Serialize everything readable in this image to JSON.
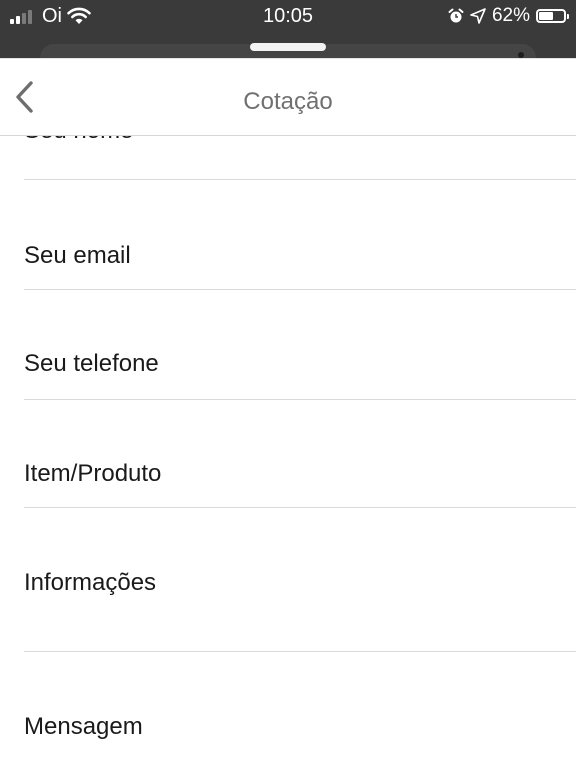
{
  "status_bar": {
    "carrier": "Oi",
    "time": "10:05",
    "battery": "62%",
    "battery_level": 0.62,
    "icons": [
      "signal-icon",
      "wifi-icon",
      "alarm-icon",
      "location-icon",
      "battery-icon"
    ]
  },
  "nav": {
    "title": "Cotação",
    "back_icon": "chevron-left-icon"
  },
  "form": {
    "nome_placeholder": "Seu nome",
    "email_placeholder": "Seu email",
    "telefone_placeholder": "Seu telefone",
    "item_placeholder": "Item/Produto",
    "informacoes_placeholder": "Informações",
    "mensagem_placeholder": "Mensagem"
  },
  "colors": {
    "status_bar_bg": "#3a3a3a",
    "title_text": "#707070",
    "field_text": "#1a1a1a",
    "divider": "#d9d9d9"
  }
}
